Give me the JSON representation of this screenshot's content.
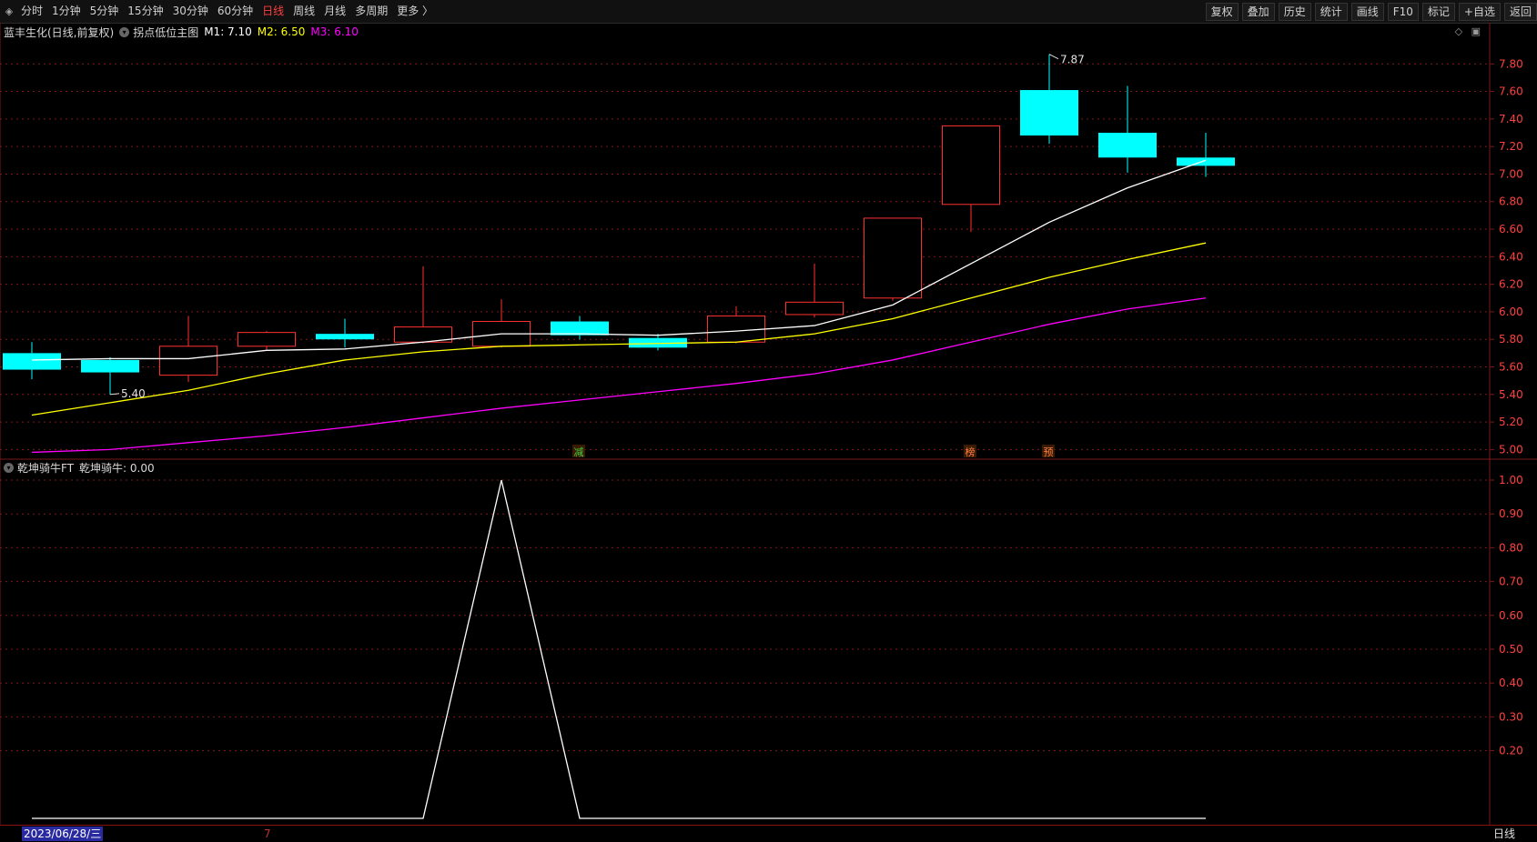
{
  "toolbar": {
    "tabs": [
      "分时",
      "1分钟",
      "5分钟",
      "15分钟",
      "30分钟",
      "60分钟",
      "日线",
      "周线",
      "月线",
      "多周期",
      "更多 〉"
    ],
    "active_tab": "日线",
    "buttons": [
      "复权",
      "叠加",
      "历史",
      "统计",
      "画线",
      "F10",
      "标记",
      "+自选",
      "返回"
    ]
  },
  "main_chart": {
    "stock_title": "蓝丰生化(日线,前复权)",
    "indicator_name": "拐点低位主图",
    "m1_label": "M1: 7.10",
    "m2_label": "M2: 6.50",
    "m3_label": "M3: 6.10",
    "high_marker": "7.87",
    "low_marker": "5.40"
  },
  "sub_chart": {
    "indicator_name": "乾坤骑牛FT",
    "value_label": "乾坤骑牛: 0.00"
  },
  "signals": [
    {
      "text": "减",
      "bar": 7,
      "color": "#40d040"
    },
    {
      "text": "榜",
      "bar": 12,
      "color": "#ff8040"
    },
    {
      "text": "预",
      "bar": 13,
      "color": "#ff8040"
    }
  ],
  "status_bar": {
    "date": "2023/06/28/三",
    "tick": "7",
    "period": "日线"
  },
  "colors": {
    "up": "#ff3030",
    "down": "#00ffff",
    "m1": "#ffffff",
    "m2": "#ffff00",
    "m3": "#ff00ff",
    "grid": "#7a1a1a",
    "axis_text": "#ff4040"
  },
  "chart_data": [
    {
      "type": "candlestick",
      "y_ticks": [
        "5.00",
        "5.20",
        "5.40",
        "5.60",
        "5.80",
        "6.00",
        "6.20",
        "6.40",
        "6.60",
        "6.80",
        "7.00",
        "7.20",
        "7.40",
        "7.60",
        "7.80"
      ],
      "ylim": [
        4.93,
        7.98
      ],
      "candles": [
        {
          "o": 5.7,
          "h": 5.78,
          "l": 5.51,
          "c": 5.58
        },
        {
          "o": 5.65,
          "h": 5.67,
          "l": 5.4,
          "c": 5.56
        },
        {
          "o": 5.54,
          "h": 5.97,
          "l": 5.49,
          "c": 5.75
        },
        {
          "o": 5.75,
          "h": 5.86,
          "l": 5.72,
          "c": 5.85
        },
        {
          "o": 5.84,
          "h": 5.95,
          "l": 5.74,
          "c": 5.8
        },
        {
          "o": 5.78,
          "h": 6.33,
          "l": 5.77,
          "c": 5.89
        },
        {
          "o": 5.75,
          "h": 6.09,
          "l": 5.74,
          "c": 5.93
        },
        {
          "o": 5.93,
          "h": 5.97,
          "l": 5.8,
          "c": 5.83
        },
        {
          "o": 5.81,
          "h": 5.84,
          "l": 5.72,
          "c": 5.74
        },
        {
          "o": 5.78,
          "h": 6.04,
          "l": 5.77,
          "c": 5.97
        },
        {
          "o": 5.98,
          "h": 6.35,
          "l": 5.96,
          "c": 6.07
        },
        {
          "o": 6.1,
          "h": 6.68,
          "l": 6.08,
          "c": 6.68
        },
        {
          "o": 6.78,
          "h": 7.35,
          "l": 6.58,
          "c": 7.35
        },
        {
          "o": 7.61,
          "h": 7.87,
          "l": 7.22,
          "c": 7.28
        },
        {
          "o": 7.3,
          "h": 7.64,
          "l": 7.01,
          "c": 7.12
        },
        {
          "o": 7.12,
          "h": 7.3,
          "l": 6.98,
          "c": 7.06
        }
      ],
      "series": [
        {
          "name": "M1",
          "values": [
            5.65,
            5.66,
            5.66,
            5.72,
            5.73,
            5.78,
            5.84,
            5.84,
            5.83,
            5.86,
            5.9,
            6.05,
            6.35,
            6.65,
            6.9,
            7.1
          ]
        },
        {
          "name": "M2",
          "values": [
            5.25,
            5.34,
            5.43,
            5.55,
            5.65,
            5.71,
            5.75,
            5.76,
            5.77,
            5.78,
            5.84,
            5.95,
            6.1,
            6.25,
            6.38,
            6.5
          ]
        },
        {
          "name": "M3",
          "values": [
            4.98,
            5.0,
            5.05,
            5.1,
            5.16,
            5.23,
            5.3,
            5.36,
            5.42,
            5.48,
            5.55,
            5.65,
            5.78,
            5.91,
            6.02,
            6.1
          ]
        }
      ]
    },
    {
      "type": "line",
      "y_ticks": [
        "0.20",
        "0.30",
        "0.40",
        "0.50",
        "0.60",
        "0.70",
        "0.80",
        "0.90",
        "1.00"
      ],
      "ylim": [
        0,
        1
      ],
      "series": [
        {
          "name": "乾坤骑牛",
          "values": [
            0,
            0,
            0,
            0,
            0,
            0,
            1,
            0,
            0,
            0,
            0,
            0,
            0,
            0,
            0,
            0
          ]
        }
      ]
    }
  ]
}
